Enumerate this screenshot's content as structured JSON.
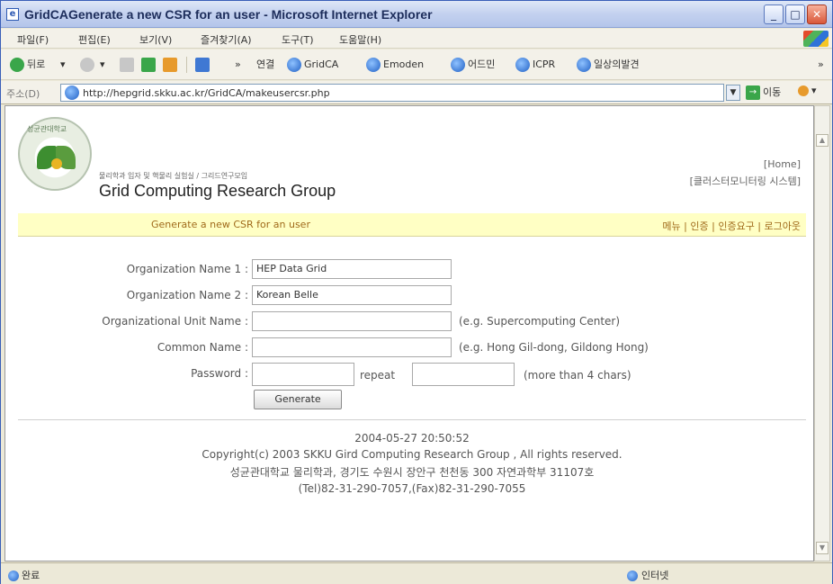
{
  "window": {
    "title": "GridCAGenerate a new CSR for an user - Microsoft Internet Explorer",
    "min_glyph": "_",
    "max_glyph": "□",
    "close_glyph": "✕"
  },
  "menu": [
    "파일(F)",
    "편집(E)",
    "보기(V)",
    "즐겨찾기(A)",
    "도구(T)",
    "도움말(H)"
  ],
  "toolbar": {
    "back_label": "뒤로",
    "back_arrow": "▾",
    "forward_arrow": "▾",
    "chevron": "»",
    "links_label": "연결",
    "links": [
      "GridCA",
      "Emoden",
      "어드민",
      "ICPR",
      "일상의발견"
    ],
    "more": "»"
  },
  "address": {
    "label": "주소(D)",
    "url": "http://hepgrid.skku.ac.kr/GridCA/makeusercsr.php",
    "go_label": "이동",
    "drop_glyph": "▼",
    "links_menu": "▾"
  },
  "header": {
    "subtitle": "물리학과 입자 및 핵물리 실험실 / 그리드연구모임",
    "org_title": "Grid Computing Research Group",
    "home_link": "[Home]",
    "cluster_link": "[클러스터모니터링 시스템]",
    "logo_text": "성균관대학교"
  },
  "navbar": {
    "heading": "Generate a new CSR for an user",
    "links": [
      "메뉴",
      "인증",
      "인증요구",
      "로그아웃"
    ],
    "separator": " | "
  },
  "form": {
    "org1_label": "Organization Name 1 :",
    "org1_value": "HEP Data Grid",
    "org2_label": "Organization Name 2 :",
    "org2_value": "Korean Belle",
    "unit_label": "Organizational Unit Name :",
    "unit_value": "",
    "unit_hint": "(e.g. Supercomputing Center)",
    "cn_label": "Common Name :",
    "cn_value": "",
    "cn_hint": "(e.g. Hong Gil-dong, Gildong Hong)",
    "pw_label": "Password :",
    "pw_value": "",
    "repeat_label": "repeat",
    "repeat_value": "",
    "pw_hint": "(more than 4 chars)",
    "generate_label": "Generate"
  },
  "footer": {
    "timestamp": "2004-05-27 20:50:52",
    "copyright": "Copyright(c) 2003 SKKU Gird Computing Research Group , All rights reserved.",
    "address": "성균관대학교 물리학과, 경기도 수원시 장안구 천천동 300 자연과학부 31107호",
    "phone": "(Tel)82-31-290-7057,(Fax)82-31-290-7055"
  },
  "status": {
    "left": "완료",
    "right": "인터넷"
  },
  "scroll": {
    "up": "▲",
    "down": "▼"
  }
}
